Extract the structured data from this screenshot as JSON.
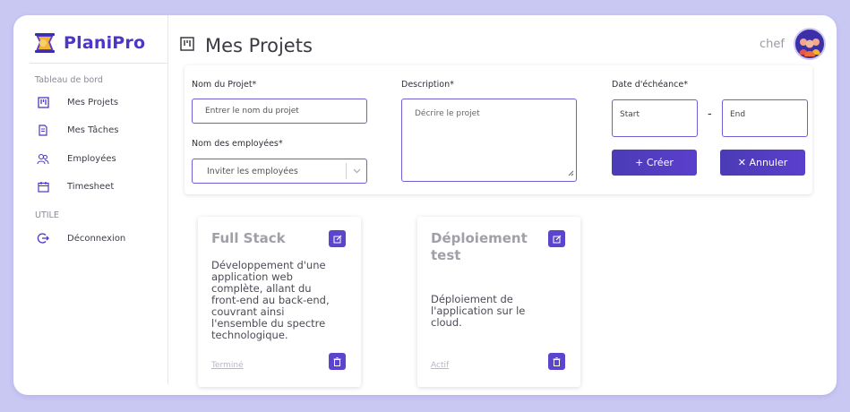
{
  "app": {
    "name": "PlaniPro",
    "accent": "#4f35c8"
  },
  "sidebar": {
    "section_dashboard": "Tableau de bord",
    "items": [
      {
        "label": "Mes Projets",
        "icon": "board-icon"
      },
      {
        "label": "Mes Tâches",
        "icon": "document-icon"
      },
      {
        "label": "Employées",
        "icon": "users-icon"
      },
      {
        "label": "Timesheet",
        "icon": "calendar-icon"
      }
    ],
    "section_util": "UTILE",
    "logout": {
      "label": "Déconnexion",
      "icon": "logout-icon"
    }
  },
  "header": {
    "title": "Mes Projets",
    "user": "chef"
  },
  "form": {
    "project_name_label": "Nom du Projet*",
    "project_name_placeholder": "Entrer le nom du projet",
    "employees_label": "Nom des employées*",
    "employees_placeholder": "Inviter les employées",
    "description_label": "Description*",
    "description_placeholder": "Décrire le projet",
    "due_date_label": "Date d'échéance*",
    "start_placeholder": "Start",
    "end_placeholder": "End",
    "range_separator": "-",
    "create_label": "+ Créer",
    "cancel_label": "✕ Annuler"
  },
  "projects": [
    {
      "title": "Full Stack",
      "description": "Développement d'une application web complète, allant du front-end au back-end, couvrant ainsi l'ensemble du spectre technologique.",
      "status": "Terminé"
    },
    {
      "title": "Déploiement test",
      "description": "Déploiement de l'application sur le cloud.",
      "status": "Actif"
    }
  ]
}
